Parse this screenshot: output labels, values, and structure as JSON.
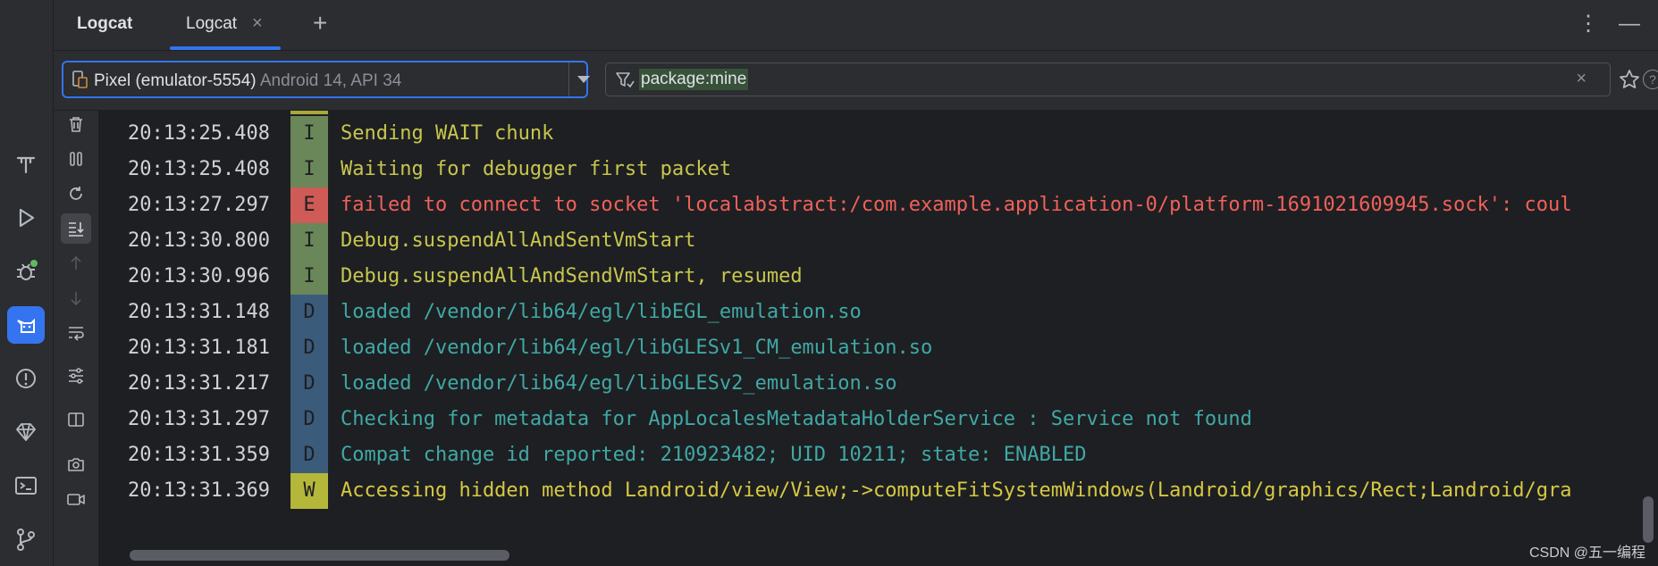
{
  "top": {
    "tool_title": "Logcat",
    "tab_label": "Logcat",
    "tab_close": "×",
    "add_tab": "+",
    "more": "⋮",
    "minimize": "—"
  },
  "device": {
    "name": "Pixel (emulator-5554)",
    "version": "Android 14, API 34"
  },
  "filter": {
    "query": "package:mine",
    "clear": "×"
  },
  "colors": {
    "accent": "#3574f0",
    "info_badge": "#6a8759",
    "error_badge": "#cf5b56",
    "debug_badge": "#3b5b7a",
    "warn_badge": "#b5b73a",
    "info_text": "#c7c64e",
    "error_text": "#f0615a",
    "debug_text": "#3fa9a6",
    "warn_text": "#d6c843"
  },
  "left_toolbar": [
    "build-icon",
    "run-icon",
    "debug-icon",
    "logcat-icon",
    "problems-icon",
    "gem-icon",
    "terminal-icon",
    "git-icon"
  ],
  "side_tools": [
    "trash-icon",
    "pause-icon",
    "restart-icon",
    "scroll-to-end-icon",
    "up-arrow-icon",
    "down-arrow-icon",
    "soft-wrap-icon",
    "settings-icon",
    "split-icon",
    "screenshot-icon",
    "screen-record-icon"
  ],
  "logs": [
    {
      "time": "20:13:25.408",
      "level": "I",
      "message": "Sending WAIT chunk"
    },
    {
      "time": "20:13:25.408",
      "level": "I",
      "message": "Waiting for debugger first packet"
    },
    {
      "time": "20:13:27.297",
      "level": "E",
      "message": "failed to connect to socket 'localabstract:/com.example.application-0/platform-1691021609945.sock': coul"
    },
    {
      "time": "20:13:30.800",
      "level": "I",
      "message": "Debug.suspendAllAndSentVmStart"
    },
    {
      "time": "20:13:30.996",
      "level": "I",
      "message": "Debug.suspendAllAndSendVmStart, resumed"
    },
    {
      "time": "20:13:31.148",
      "level": "D",
      "message": "loaded /vendor/lib64/egl/libEGL_emulation.so"
    },
    {
      "time": "20:13:31.181",
      "level": "D",
      "message": "loaded /vendor/lib64/egl/libGLESv1_CM_emulation.so"
    },
    {
      "time": "20:13:31.217",
      "level": "D",
      "message": "loaded /vendor/lib64/egl/libGLESv2_emulation.so"
    },
    {
      "time": "20:13:31.297",
      "level": "D",
      "message": "Checking for metadata for AppLocalesMetadataHolderService : Service not found"
    },
    {
      "time": "20:13:31.359",
      "level": "D",
      "message": "Compat change id reported: 210923482; UID 10211; state: ENABLED"
    },
    {
      "time": "20:13:31.369",
      "level": "W",
      "message": "Accessing hidden method Landroid/view/View;->computeFitSystemWindows(Landroid/graphics/Rect;Landroid/gra"
    }
  ],
  "watermark": "CSDN @五一编程"
}
